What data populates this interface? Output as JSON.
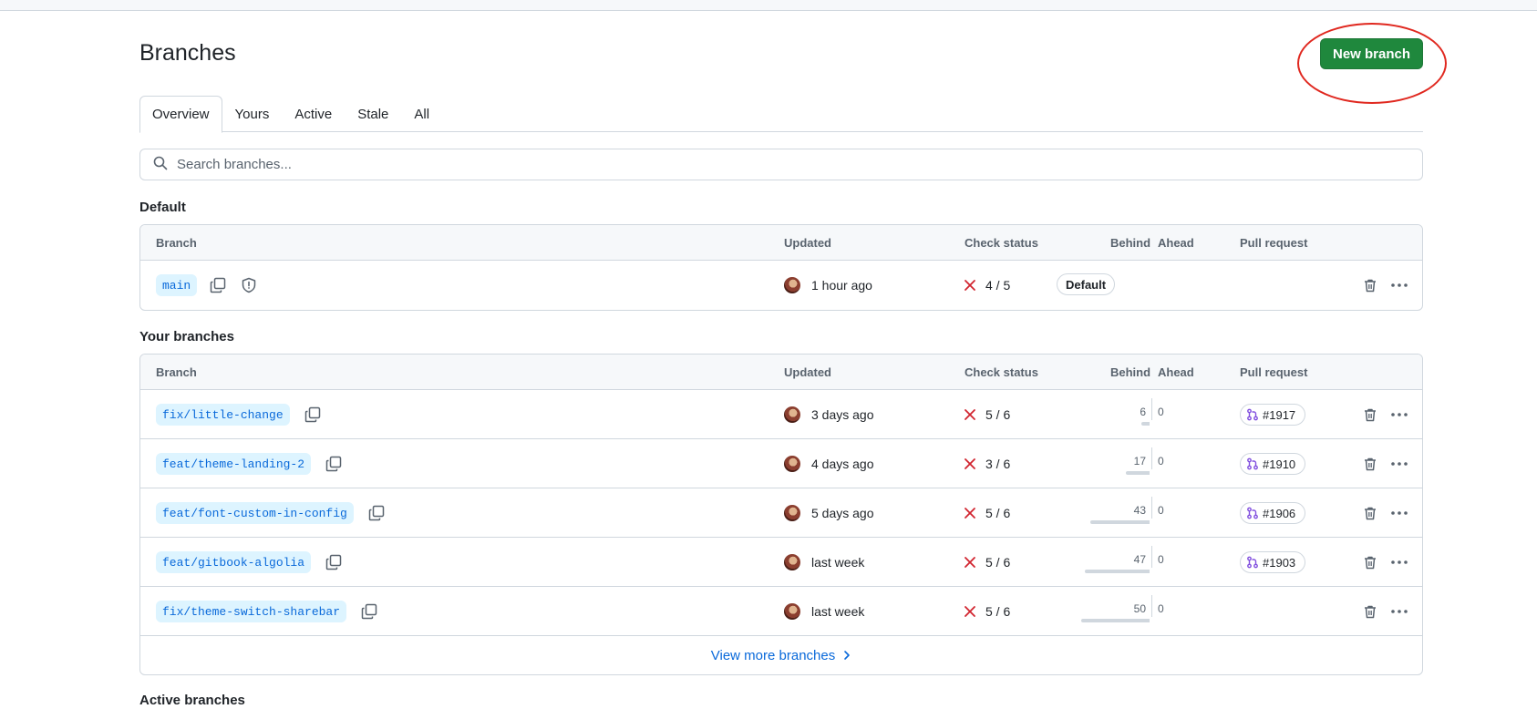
{
  "header": {
    "title": "Branches",
    "new_branch_label": "New branch"
  },
  "tabs": [
    {
      "label": "Overview",
      "selected": true
    },
    {
      "label": "Yours",
      "selected": false
    },
    {
      "label": "Active",
      "selected": false
    },
    {
      "label": "Stale",
      "selected": false
    },
    {
      "label": "All",
      "selected": false
    }
  ],
  "search": {
    "placeholder": "Search branches...",
    "value": ""
  },
  "columns": {
    "branch": "Branch",
    "updated": "Updated",
    "check_status": "Check status",
    "behind": "Behind",
    "ahead": "Ahead",
    "pull_request": "Pull request"
  },
  "default_section": {
    "title": "Default",
    "branch": {
      "name": "main",
      "updated": "1 hour ago",
      "check": "4 / 5",
      "label": "Default"
    }
  },
  "your_branches": {
    "title": "Your branches",
    "rows": [
      {
        "name": "fix/little-change",
        "updated": "3 days ago",
        "check": "5 / 6",
        "behind": "6",
        "ahead": "0",
        "pr": "#1917"
      },
      {
        "name": "feat/theme-landing-2",
        "updated": "4 days ago",
        "check": "3 / 6",
        "behind": "17",
        "ahead": "0",
        "pr": "#1910"
      },
      {
        "name": "feat/font-custom-in-config",
        "updated": "5 days ago",
        "check": "5 / 6",
        "behind": "43",
        "ahead": "0",
        "pr": "#1906"
      },
      {
        "name": "feat/gitbook-algolia",
        "updated": "last week",
        "check": "5 / 6",
        "behind": "47",
        "ahead": "0",
        "pr": "#1903"
      },
      {
        "name": "fix/theme-switch-sharebar",
        "updated": "last week",
        "check": "5 / 6",
        "behind": "50",
        "ahead": "0",
        "pr": ""
      }
    ],
    "view_more_label": "View more branches"
  },
  "active_section": {
    "title": "Active branches"
  },
  "colors": {
    "primary_button": "#1f883d",
    "link": "#0969da",
    "branch_pill_bg": "#ddf4ff",
    "failure": "#d1242f",
    "pr_icon": "#8250df",
    "annotation": "#e0281f"
  }
}
